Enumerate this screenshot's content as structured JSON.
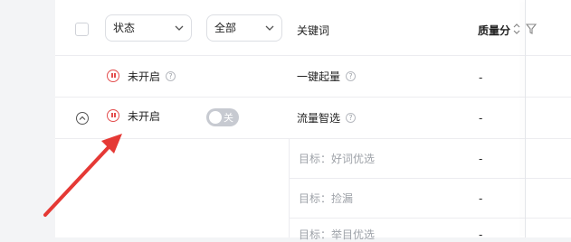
{
  "header": {
    "status_select": "状态",
    "filter_select": "全部",
    "keyword_label": "关键词",
    "quality_label": "质量分"
  },
  "rows": [
    {
      "status": "未开启",
      "keyword": "一键起量",
      "quality": "-"
    },
    {
      "status": "未开启",
      "toggle_label": "关",
      "keyword": "流量智选",
      "quality": "-"
    }
  ],
  "sub_rows": [
    {
      "target": "目标：好词优选",
      "quality": "-"
    },
    {
      "target": "目标：捡漏",
      "quality": "-"
    },
    {
      "target": "目标：举目优选",
      "quality": "-"
    }
  ],
  "annotation": {
    "color": "#e53935"
  }
}
